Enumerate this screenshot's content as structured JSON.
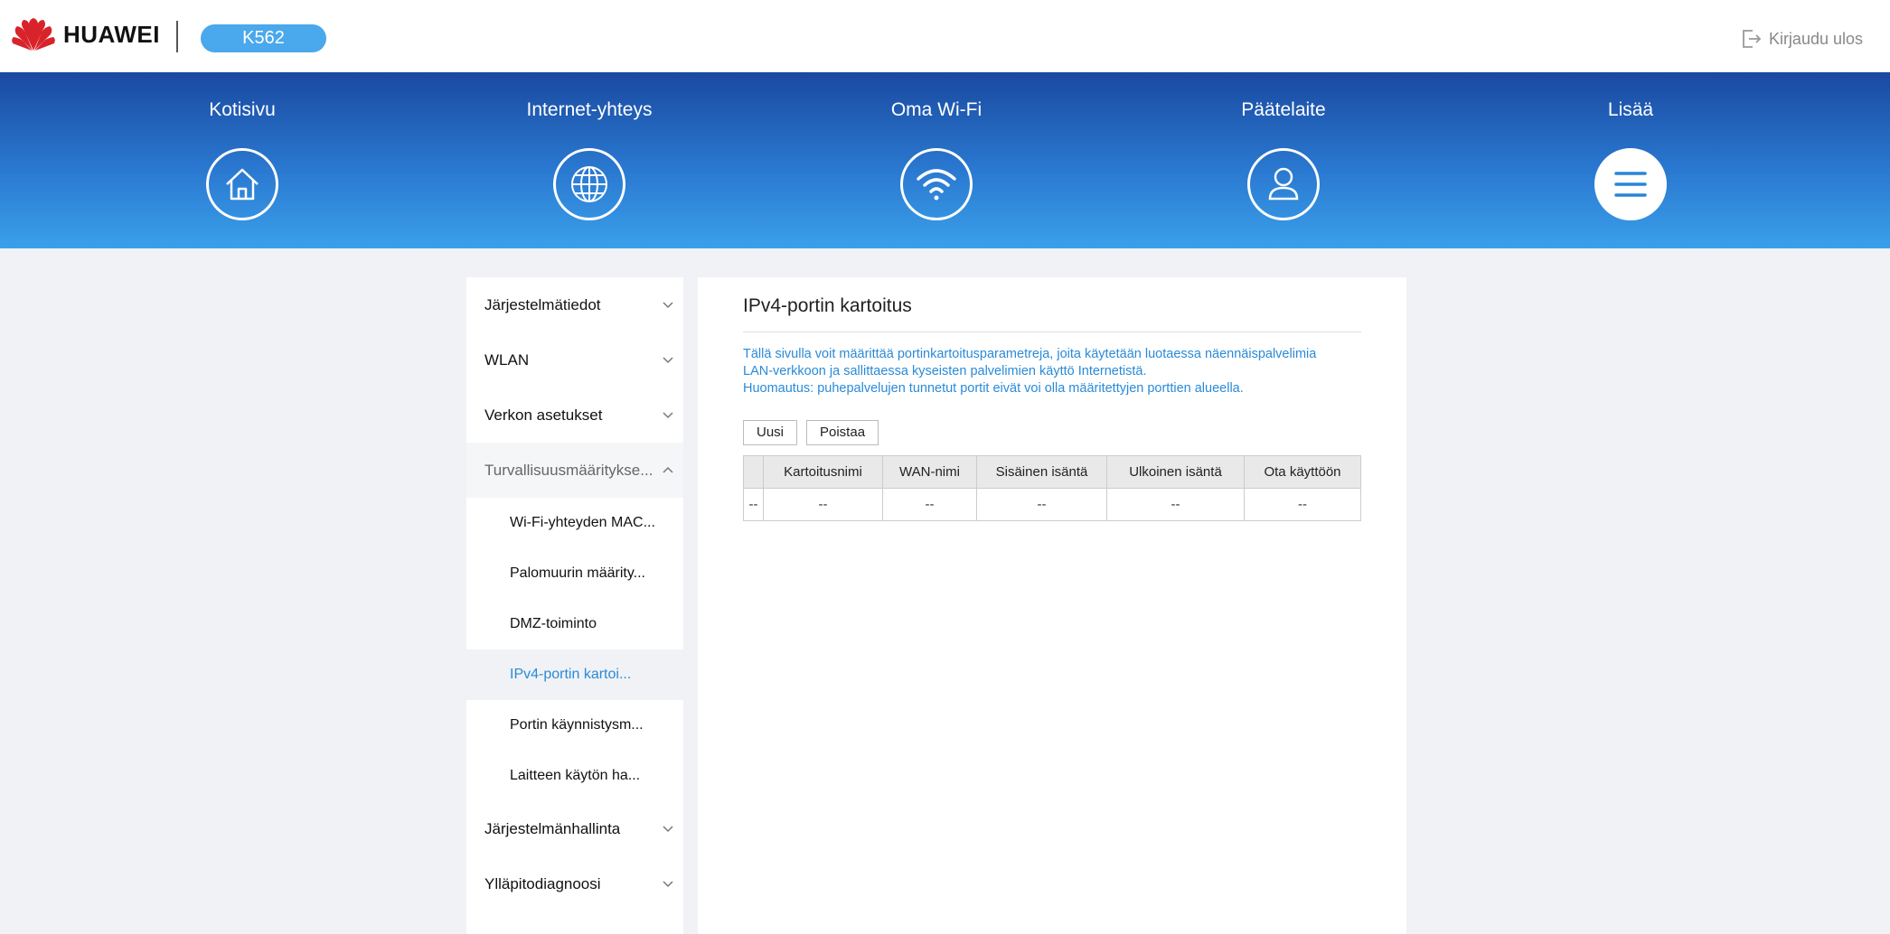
{
  "header": {
    "brand": "HUAWEI",
    "model": "K562",
    "logout_label": "Kirjaudu ulos"
  },
  "nav": [
    {
      "label": "Kotisivu",
      "icon": "home-icon"
    },
    {
      "label": "Internet-yhteys",
      "icon": "globe-icon"
    },
    {
      "label": "Oma Wi-Fi",
      "icon": "wifi-icon"
    },
    {
      "label": "Päätelaite",
      "icon": "user-icon"
    },
    {
      "label": "Lisää",
      "icon": "menu-icon",
      "active": true
    }
  ],
  "sidebar": {
    "items": [
      {
        "label": "Järjestelmätiedot"
      },
      {
        "label": "WLAN"
      },
      {
        "label": "Verkon asetukset"
      },
      {
        "label": "Turvallisuusmääritykse..."
      },
      {
        "label": "Järjestelmänhallinta"
      },
      {
        "label": "Ylläpitodiagnoosi"
      }
    ],
    "subitems": [
      {
        "label": "Wi-Fi-yhteyden MAC..."
      },
      {
        "label": "Palomuurin määrity..."
      },
      {
        "label": "DMZ-toiminto"
      },
      {
        "label": "IPv4-portin kartoi...",
        "active": true
      },
      {
        "label": "Portin käynnistysm..."
      },
      {
        "label": "Laitteen käytön ha..."
      }
    ]
  },
  "main": {
    "title": "IPv4-portin kartoitus",
    "description": [
      "Tällä sivulla voit määrittää portinkartoitusparametreja, joita käytetään luotaessa näennäispalvelimia",
      "LAN-verkkoon ja sallittaessa kyseisten palvelimien käyttö Internetistä.",
      "Huomautus: puhepalvelujen tunnetut portit eivät voi olla määritettyjen porttien alueella."
    ],
    "new_button": "Uusi",
    "delete_button": "Poistaa",
    "table": {
      "headers": [
        "",
        "Kartoitusnimi",
        "WAN-nimi",
        "Sisäinen isäntä",
        "Ulkoinen isäntä",
        "Ota käyttöön"
      ],
      "rows": [
        [
          "--",
          "--",
          "--",
          "--",
          "--",
          "--"
        ]
      ]
    }
  },
  "colors": {
    "accent": "#2a8ad8",
    "pill": "#4aa8ec",
    "nav_top": "#1a49a0",
    "nav_bottom": "#3aa0ea"
  }
}
